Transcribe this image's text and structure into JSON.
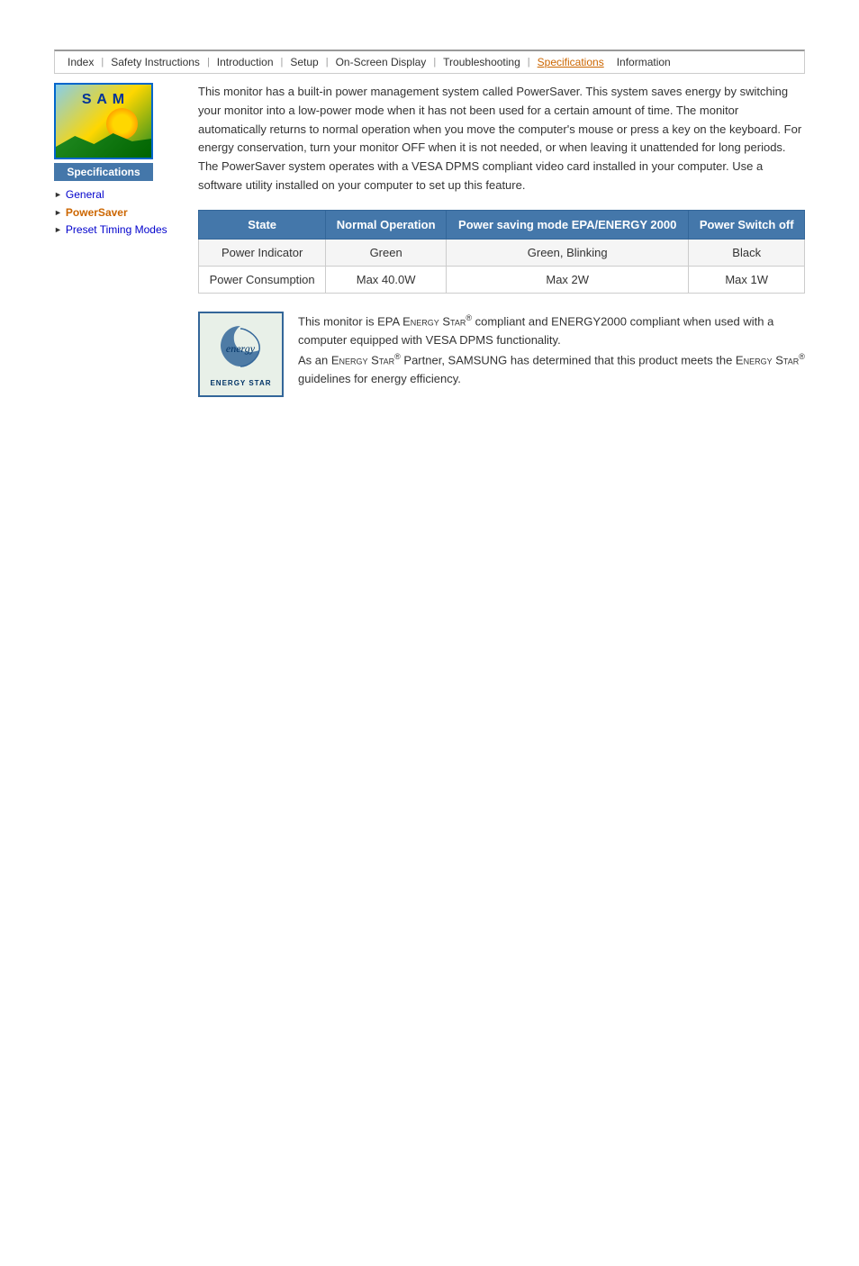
{
  "nav": {
    "items": [
      {
        "label": "Index",
        "id": "index",
        "active": false
      },
      {
        "label": "Safety Instructions",
        "id": "safety",
        "active": false
      },
      {
        "label": "Introduction",
        "id": "introduction",
        "active": false
      },
      {
        "label": "Setup",
        "id": "setup",
        "active": false
      },
      {
        "label": "On-Screen Display",
        "id": "osd",
        "active": false
      },
      {
        "label": "Troubleshooting",
        "id": "troubleshooting",
        "active": false
      },
      {
        "label": "Specifications",
        "id": "specifications",
        "active": true
      },
      {
        "label": "Information",
        "id": "information",
        "active": false
      }
    ]
  },
  "sidebar": {
    "logo_alt": "Samsung Monitor",
    "section_title": "Specifications",
    "items": [
      {
        "label": "General",
        "id": "general",
        "current": false
      },
      {
        "label": "PowerSaver",
        "id": "powersaver",
        "current": true
      },
      {
        "label": "Preset Timing Modes",
        "id": "preset",
        "current": false
      }
    ]
  },
  "content": {
    "intro_text": "This monitor has a built-in power management system called PowerSaver. This system saves energy by switching your monitor into a low-power mode when it has not been used for a certain amount of time. The monitor automatically returns to normal operation when you move the computer's mouse or press a key on the keyboard. For energy conservation, turn your monitor OFF when it is not needed, or when leaving it unattended for long periods. The PowerSaver system operates with a VESA DPMS compliant video card installed in your computer. Use a software utility installed on your computer to set up this feature.",
    "table": {
      "headers": [
        "State",
        "Normal Operation",
        "Power saving mode EPA/ENERGY 2000",
        "Power Switch off"
      ],
      "rows": [
        [
          "Power Indicator",
          "Green",
          "Green, Blinking",
          "Black"
        ],
        [
          "Power Consumption",
          "Max 40.0W",
          "Max 2W",
          "Max 1W"
        ]
      ]
    },
    "energy_star": {
      "text_1": "This monitor is EPA Energy Star® compliant and ENERGY2000 compliant when used with a computer equipped with VESA DPMS functionality.",
      "text_2": "As an Energy Star® Partner, SAMSUNG has determined that this product meets the Energy Star® guidelines for energy efficiency.",
      "logo_label": "ENERGY STAR"
    }
  }
}
